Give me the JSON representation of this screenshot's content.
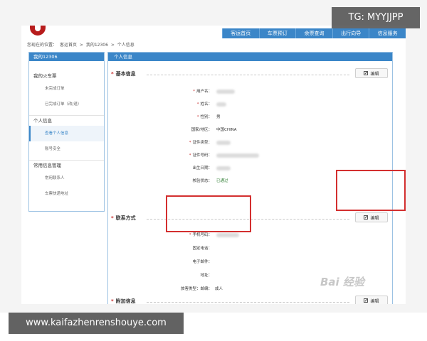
{
  "overlay": {
    "tg_label": "TG: MYYJJPP",
    "site_url": "www.kaifazhenrenshouye.com",
    "watermark": "Bai 经验"
  },
  "top_nav": {
    "items": [
      "客运首页",
      "车票预订",
      "余票查询",
      "出行向导",
      "信息服务"
    ]
  },
  "breadcrumb": {
    "prefix": "您现在的位置：",
    "items": [
      "客运首页",
      ">",
      "我的12306",
      ">",
      "个人信息"
    ]
  },
  "sidebar": {
    "header": "我的12306",
    "sections": [
      {
        "title": "我的火车票",
        "items": [
          {
            "label": "未完成订单",
            "active": false
          },
          {
            "label": "已完成订单（改/退）",
            "active": false
          }
        ]
      },
      {
        "title": "个人信息",
        "items": [
          {
            "label": "查看个人信息",
            "active": true
          },
          {
            "label": "账号安全",
            "active": false
          }
        ]
      },
      {
        "title": "常用信息管理",
        "items": [
          {
            "label": "常用联系人",
            "active": false
          },
          {
            "label": "车票快递地址",
            "active": false
          }
        ]
      }
    ]
  },
  "main": {
    "header": "个人信息",
    "edit_label": "编辑",
    "sections": {
      "basic": {
        "title": "基本信息",
        "fields": [
          {
            "label": "用户名：",
            "required": true,
            "value": ""
          },
          {
            "label": "姓名：",
            "required": true,
            "value": ""
          },
          {
            "label": "性别：",
            "required": true,
            "value": "男"
          },
          {
            "label": "国家/地区：",
            "required": false,
            "value": "中国CHINA"
          },
          {
            "label": "证件类型：",
            "required": true,
            "value": ""
          },
          {
            "label": "证件号码：",
            "required": true,
            "value": ""
          },
          {
            "label": "出生日期：",
            "required": false,
            "value": ""
          },
          {
            "label": "核验状态：",
            "required": false,
            "value": "已通过"
          }
        ]
      },
      "contact": {
        "title": "联系方式",
        "fields": [
          {
            "label": "手机号码：",
            "required": true,
            "value": ""
          },
          {
            "label": "固定电话：",
            "required": false,
            "value": ""
          },
          {
            "label": "电子邮件：",
            "required": false,
            "value": ""
          },
          {
            "label": "地址：",
            "required": false,
            "value": ""
          },
          {
            "label": "邮编：",
            "required": false,
            "value": ""
          }
        ]
      },
      "extra": {
        "title": "附加信息",
        "fields": [
          {
            "label": "旅客类型：",
            "required": false,
            "value": "成人"
          }
        ]
      }
    }
  },
  "colors": {
    "accent": "#3b86c8",
    "highlight_box": "#d32f2f",
    "required_star": "#c62828",
    "verified": "#2e7d32"
  }
}
